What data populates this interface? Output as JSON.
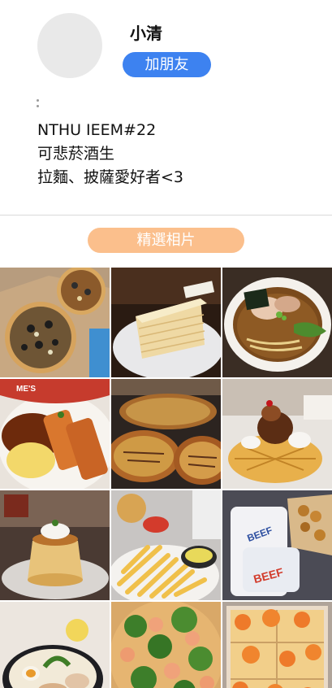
{
  "profile": {
    "name": "小清",
    "add_friend_label": "加朋友"
  },
  "bio": {
    "lines": [
      "NTHU IEEM#22",
      "可悲菸酒生",
      "拉麵、披薩愛好者<3"
    ]
  },
  "section_tab_label": "精選相片",
  "photos": [
    {
      "subject": "pizzas-in-boxes"
    },
    {
      "subject": "mille-crepe-cake"
    },
    {
      "subject": "ramen-bowl"
    },
    {
      "subject": "curry-katsu"
    },
    {
      "subject": "okonomiyaki"
    },
    {
      "subject": "ice-cream-waffle"
    },
    {
      "subject": "pudding"
    },
    {
      "subject": "fries-and-fried-chicken"
    },
    {
      "subject": "fried-food-in-paper-bags"
    },
    {
      "subject": "ramen-with-egg"
    },
    {
      "subject": "salad-pizza"
    },
    {
      "subject": "shrimp-pizza"
    }
  ]
}
